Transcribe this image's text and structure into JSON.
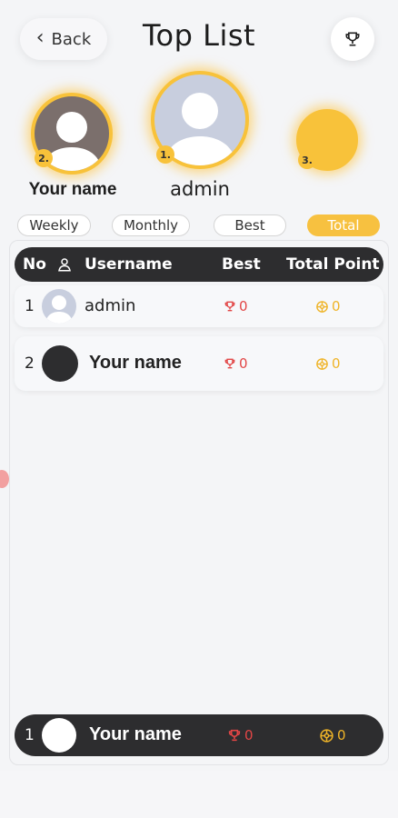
{
  "header": {
    "back_label": "Back",
    "title": "Top List"
  },
  "podium": [
    {
      "rank": "2.",
      "name": "Your name"
    },
    {
      "rank": "1.",
      "name": "admin"
    },
    {
      "rank": "3.",
      "name": ""
    }
  ],
  "tabs": [
    {
      "label": "Weekly"
    },
    {
      "label": "Monthly"
    },
    {
      "label": "Best"
    },
    {
      "label": "Total",
      "active": true
    }
  ],
  "table": {
    "headers": {
      "no": "No",
      "username": "Username",
      "best": "Best",
      "total": "Total Point"
    },
    "rows": [
      {
        "no": "1",
        "username": "admin",
        "best": "0",
        "points": "0"
      },
      {
        "no": "2",
        "username": "Your name",
        "best": "0",
        "points": "0"
      }
    ]
  },
  "current_user": {
    "no": "1",
    "username": "Your name",
    "best": "0",
    "points": "0"
  },
  "colors": {
    "accent": "#f7c140",
    "dark": "#2d2d2f",
    "best": "#e24646",
    "points": "#efb428"
  }
}
